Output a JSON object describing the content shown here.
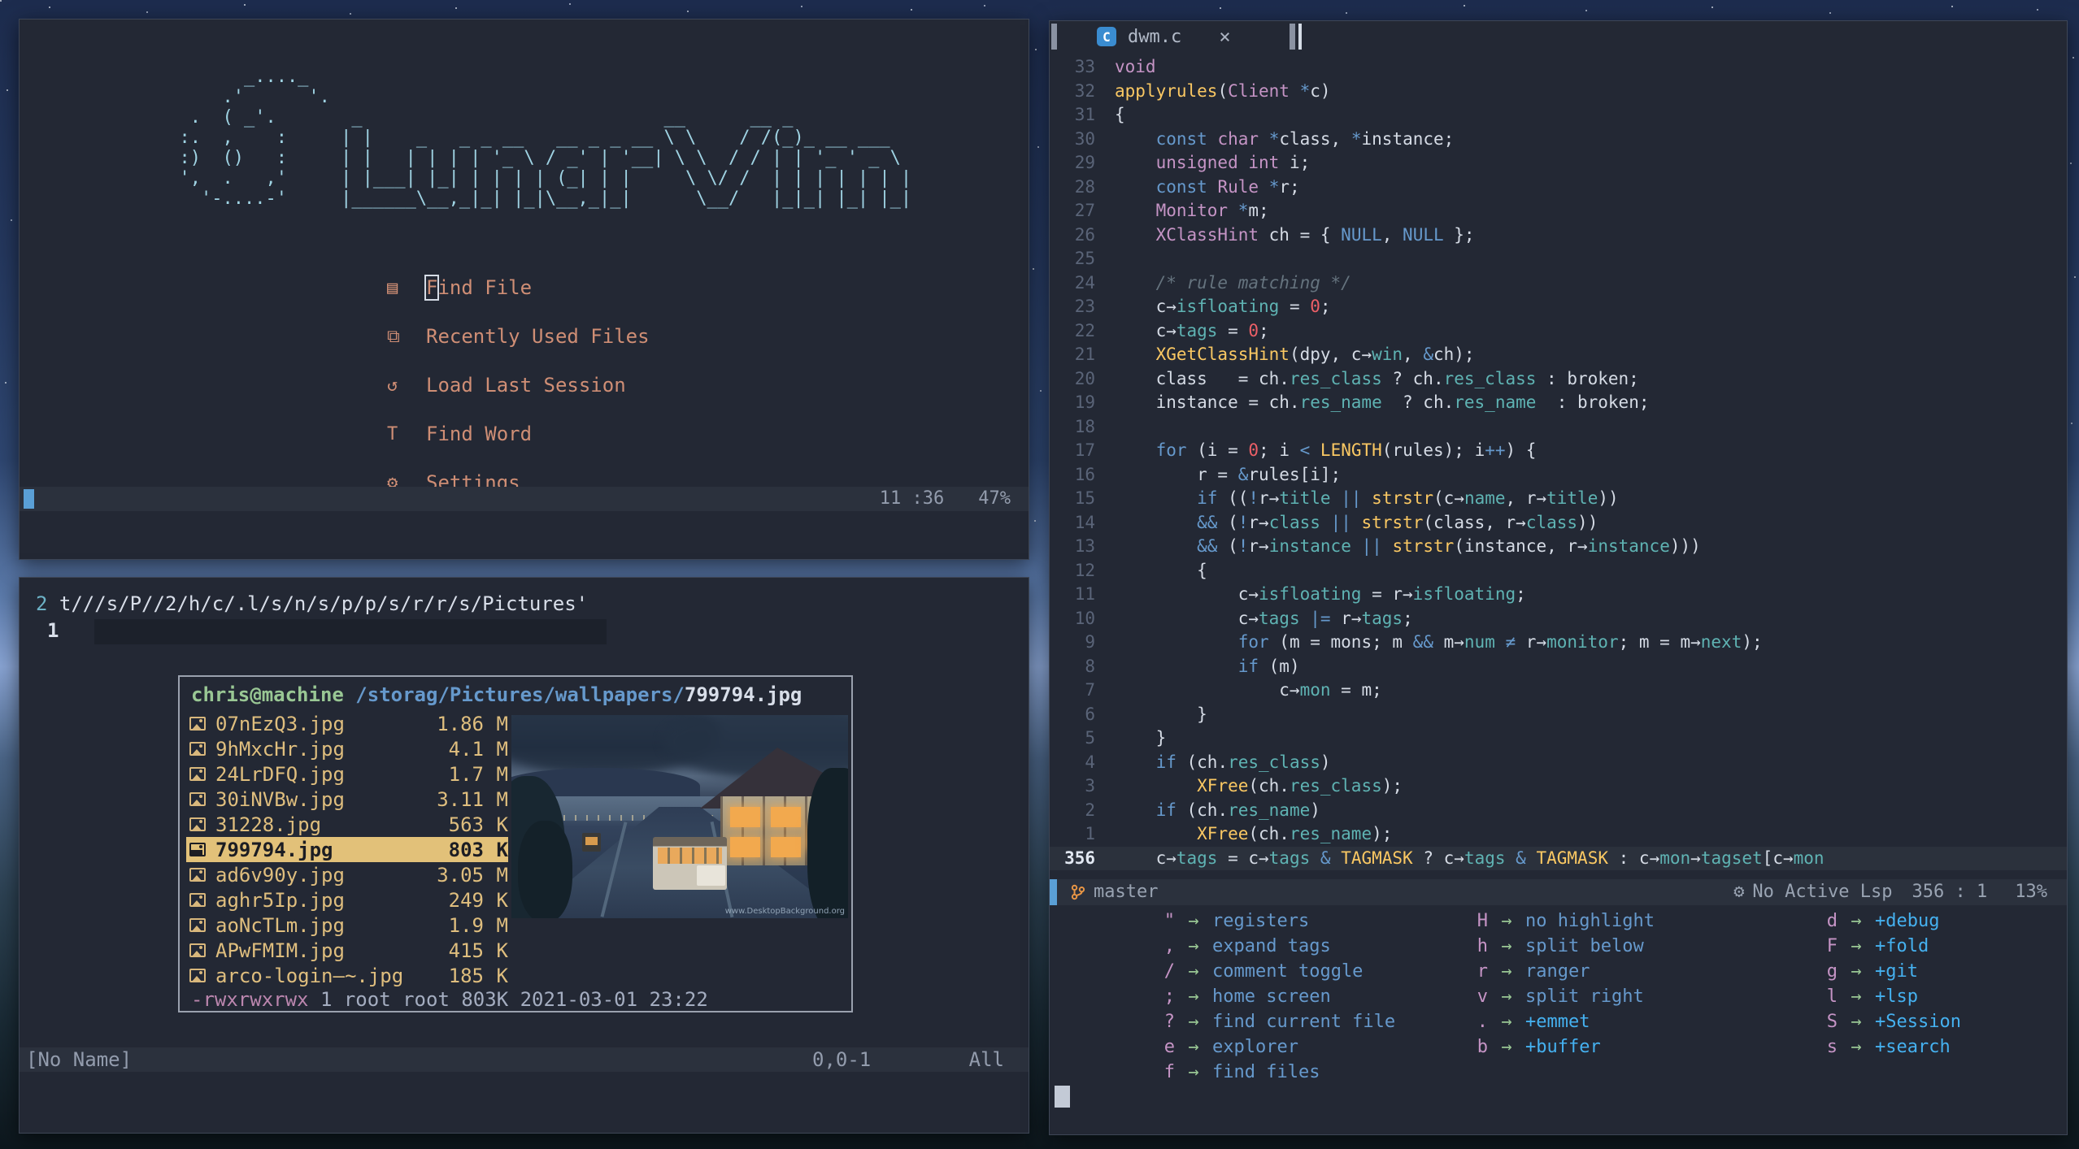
{
  "colors": {
    "bg": "#232834",
    "statusline_bg": "#2b313d",
    "accent_blue": "#5a9fd6",
    "menu_salmon": "#cf8e75",
    "logo_cyan": "#9fd3e3",
    "file_tan": "#dfbe7e",
    "select_tan": "#e2c179",
    "kw_blue": "#6699cc",
    "type_pink": "#c594c5",
    "fn_yellow": "#fac863",
    "member_teal": "#5fb3b3",
    "num_red": "#ec5f67",
    "green": "#99c794",
    "group_cyan": "#45b1f0",
    "branch_orange": "#e79545"
  },
  "lunarvim": {
    "ascii_art": "        _...._\n      .'      '.\n   .  ( _'.       _                            __      __ _\n  :.  ,    :     | |    _   _ _ __   __ _ _ __ \\ \\    / /(_)_ __ ___\n  :)  ()   :     | |   | | | | '_ \\ / _' | '__| \\ \\  / / | | '_ ' _ \\\n  ',  .   ,'     | |___| |_| | | | | (_| | |     \\ \\/ /  | | | | | | |\n    '-....-'     |______\\__,_|_| |_|\\__,_|_|      \\__/   |_|_| |_| |_|",
    "menu": [
      {
        "icon": "▤",
        "icon_name": "document-icon",
        "label": "Find File",
        "cursor": true
      },
      {
        "icon": "⧉",
        "icon_name": "copy-icon",
        "label": "Recently Used Files"
      },
      {
        "icon": "↺",
        "icon_name": "reload-icon",
        "label": "Load Last Session"
      },
      {
        "icon": "T",
        "icon_name": "text-icon",
        "label": "Find Word"
      },
      {
        "icon": "⚙",
        "icon_name": "gear-icon",
        "label": "Settings"
      }
    ],
    "statusline": {
      "time": "11 :36",
      "percent": "47%"
    }
  },
  "terminal": {
    "cmdline": {
      "num1": "2",
      "text": "t///s/P//2/h/c/.l/s/n/s/p/p/s/r/r/s/Pictures'",
      "num2": "1"
    },
    "fm": {
      "user": "chris@machine",
      "path": "/storag/Pictures/wallpapers/",
      "file": "799794.jpg",
      "files": [
        {
          "name": "07nEzQ3.jpg",
          "num": "1.86",
          "unit": "M"
        },
        {
          "name": "9hMxcHr.jpg",
          "num": "4.1",
          "unit": "M"
        },
        {
          "name": "24LrDFQ.jpg",
          "num": "1.7",
          "unit": "M"
        },
        {
          "name": "30iNVBw.jpg",
          "num": "3.11",
          "unit": "M"
        },
        {
          "name": "31228.jpg",
          "num": "563",
          "unit": "K"
        },
        {
          "name": "799794.jpg",
          "num": "803",
          "unit": "K",
          "selected": true
        },
        {
          "name": "ad6v90y.jpg",
          "num": "3.05",
          "unit": "M"
        },
        {
          "name": "aghr5Ip.jpg",
          "num": "249",
          "unit": "K"
        },
        {
          "name": "aoNcTLm.jpg",
          "num": "1.9",
          "unit": "M"
        },
        {
          "name": "APwFMIM.jpg",
          "num": "415",
          "unit": "K"
        },
        {
          "name": "arco-login—~.jpg",
          "num": "185",
          "unit": "K"
        }
      ],
      "perm_bits": "-rwxrwxrwx",
      "perm_meta": " 1 root root 803K 2021-03-01 23:22",
      "watermark": "www.DesktopBackground.org"
    },
    "statusline": {
      "name": "[No Name]",
      "pos": "0,0-1",
      "scroll": "All"
    }
  },
  "editor": {
    "tab": {
      "icon": "C",
      "label": "dwm.c",
      "close": "×"
    },
    "code": [
      {
        "ln": "33",
        "s": [
          [
            "t",
            "void"
          ]
        ]
      },
      {
        "ln": "32",
        "s": [
          [
            "f",
            "applyrules"
          ],
          [
            "p",
            "("
          ],
          [
            "t",
            "Client"
          ],
          [
            "p",
            " "
          ],
          [
            "k",
            "*"
          ],
          [
            "p",
            "c)"
          ]
        ]
      },
      {
        "ln": "31",
        "s": [
          [
            "p",
            "{"
          ]
        ]
      },
      {
        "ln": "30",
        "s": [
          [
            "p",
            "    "
          ],
          [
            "k",
            "const"
          ],
          [
            "p",
            " "
          ],
          [
            "t",
            "char"
          ],
          [
            "p",
            " "
          ],
          [
            "k",
            "*"
          ],
          [
            "p",
            "class, "
          ],
          [
            "k",
            "*"
          ],
          [
            "p",
            "instance;"
          ]
        ]
      },
      {
        "ln": "29",
        "s": [
          [
            "p",
            "    "
          ],
          [
            "t",
            "unsigned"
          ],
          [
            "p",
            " "
          ],
          [
            "t",
            "int"
          ],
          [
            "p",
            " i;"
          ]
        ]
      },
      {
        "ln": "28",
        "s": [
          [
            "p",
            "    "
          ],
          [
            "k",
            "const"
          ],
          [
            "p",
            " "
          ],
          [
            "t",
            "Rule"
          ],
          [
            "p",
            " "
          ],
          [
            "k",
            "*"
          ],
          [
            "p",
            "r;"
          ]
        ]
      },
      {
        "ln": "27",
        "s": [
          [
            "p",
            "    "
          ],
          [
            "t",
            "Monitor"
          ],
          [
            "p",
            " "
          ],
          [
            "k",
            "*"
          ],
          [
            "p",
            "m;"
          ]
        ]
      },
      {
        "ln": "26",
        "s": [
          [
            "p",
            "    "
          ],
          [
            "t",
            "XClassHint"
          ],
          [
            "p",
            " ch = { "
          ],
          [
            "k",
            "NULL"
          ],
          [
            "p",
            ", "
          ],
          [
            "k",
            "NULL"
          ],
          [
            "p",
            " };"
          ]
        ]
      },
      {
        "ln": "25",
        "s": []
      },
      {
        "ln": "24",
        "s": [
          [
            "c",
            "    /* rule matching */"
          ]
        ]
      },
      {
        "ln": "23",
        "s": [
          [
            "p",
            "    c→"
          ],
          [
            "m",
            "isfloating"
          ],
          [
            "p",
            " = "
          ],
          [
            "n",
            "0"
          ],
          [
            "p",
            ";"
          ]
        ]
      },
      {
        "ln": "22",
        "s": [
          [
            "p",
            "    c→"
          ],
          [
            "m",
            "tags"
          ],
          [
            "p",
            " = "
          ],
          [
            "n",
            "0"
          ],
          [
            "p",
            ";"
          ]
        ]
      },
      {
        "ln": "21",
        "s": [
          [
            "p",
            "    "
          ],
          [
            "f",
            "XGetClassHint"
          ],
          [
            "p",
            "(dpy, c→"
          ],
          [
            "m",
            "win"
          ],
          [
            "p",
            ", "
          ],
          [
            "k",
            "&"
          ],
          [
            "p",
            "ch);"
          ]
        ]
      },
      {
        "ln": "20",
        "s": [
          [
            "p",
            "    class   = ch."
          ],
          [
            "m",
            "res_class"
          ],
          [
            "p",
            " ? ch."
          ],
          [
            "m",
            "res_class"
          ],
          [
            "p",
            " : broken;"
          ]
        ]
      },
      {
        "ln": "19",
        "s": [
          [
            "p",
            "    instance = ch."
          ],
          [
            "m",
            "res_name"
          ],
          [
            "p",
            "  ? ch."
          ],
          [
            "m",
            "res_name"
          ],
          [
            "p",
            "  : broken;"
          ]
        ]
      },
      {
        "ln": "18",
        "s": []
      },
      {
        "ln": "17",
        "s": [
          [
            "p",
            "    "
          ],
          [
            "k",
            "for"
          ],
          [
            "p",
            " (i = "
          ],
          [
            "n",
            "0"
          ],
          [
            "p",
            "; i "
          ],
          [
            "k",
            "<"
          ],
          [
            "p",
            " "
          ],
          [
            "f",
            "LENGTH"
          ],
          [
            "p",
            "(rules); i"
          ],
          [
            "k",
            "++"
          ],
          [
            "p",
            ") {"
          ]
        ]
      },
      {
        "ln": "16",
        "s": [
          [
            "p",
            "        r = "
          ],
          [
            "k",
            "&"
          ],
          [
            "p",
            "rules[i];"
          ]
        ]
      },
      {
        "ln": "15",
        "s": [
          [
            "p",
            "        "
          ],
          [
            "k",
            "if"
          ],
          [
            "p",
            " (("
          ],
          [
            "k",
            "!"
          ],
          [
            "p",
            "r→"
          ],
          [
            "m",
            "title"
          ],
          [
            "p",
            " "
          ],
          [
            "k",
            "||"
          ],
          [
            "p",
            " "
          ],
          [
            "f",
            "strstr"
          ],
          [
            "p",
            "(c→"
          ],
          [
            "m",
            "name"
          ],
          [
            "p",
            ", r→"
          ],
          [
            "m",
            "title"
          ],
          [
            "p",
            "))"
          ]
        ]
      },
      {
        "ln": "14",
        "s": [
          [
            "p",
            "        "
          ],
          [
            "k",
            "&&"
          ],
          [
            "p",
            " ("
          ],
          [
            "k",
            "!"
          ],
          [
            "p",
            "r→"
          ],
          [
            "m",
            "class"
          ],
          [
            "p",
            " "
          ],
          [
            "k",
            "||"
          ],
          [
            "p",
            " "
          ],
          [
            "f",
            "strstr"
          ],
          [
            "p",
            "(class, r→"
          ],
          [
            "m",
            "class"
          ],
          [
            "p",
            "))"
          ]
        ]
      },
      {
        "ln": "13",
        "s": [
          [
            "p",
            "        "
          ],
          [
            "k",
            "&&"
          ],
          [
            "p",
            " ("
          ],
          [
            "k",
            "!"
          ],
          [
            "p",
            "r→"
          ],
          [
            "m",
            "instance"
          ],
          [
            "p",
            " "
          ],
          [
            "k",
            "||"
          ],
          [
            "p",
            " "
          ],
          [
            "f",
            "strstr"
          ],
          [
            "p",
            "(instance, r→"
          ],
          [
            "m",
            "instance"
          ],
          [
            "p",
            ")))"
          ]
        ]
      },
      {
        "ln": "12",
        "s": [
          [
            "p",
            "        {"
          ]
        ]
      },
      {
        "ln": "11",
        "s": [
          [
            "p",
            "            c→"
          ],
          [
            "m",
            "isfloating"
          ],
          [
            "p",
            " = r→"
          ],
          [
            "m",
            "isfloating"
          ],
          [
            "p",
            ";"
          ]
        ]
      },
      {
        "ln": "10",
        "s": [
          [
            "p",
            "            c→"
          ],
          [
            "m",
            "tags"
          ],
          [
            "p",
            " "
          ],
          [
            "k",
            "|="
          ],
          [
            "p",
            " r→"
          ],
          [
            "m",
            "tags"
          ],
          [
            "p",
            ";"
          ]
        ]
      },
      {
        "ln": "9",
        "s": [
          [
            "p",
            "            "
          ],
          [
            "k",
            "for"
          ],
          [
            "p",
            " (m = mons; m "
          ],
          [
            "k",
            "&&"
          ],
          [
            "p",
            " m→"
          ],
          [
            "m",
            "num"
          ],
          [
            "p",
            " "
          ],
          [
            "k",
            "≠"
          ],
          [
            "p",
            " r→"
          ],
          [
            "m",
            "monitor"
          ],
          [
            "p",
            "; m = m→"
          ],
          [
            "m",
            "next"
          ],
          [
            "p",
            ");"
          ]
        ]
      },
      {
        "ln": "8",
        "s": [
          [
            "p",
            "            "
          ],
          [
            "k",
            "if"
          ],
          [
            "p",
            " (m)"
          ]
        ]
      },
      {
        "ln": "7",
        "s": [
          [
            "p",
            "                c→"
          ],
          [
            "m",
            "mon"
          ],
          [
            "p",
            " = m;"
          ]
        ]
      },
      {
        "ln": "6",
        "s": [
          [
            "p",
            "        }"
          ]
        ]
      },
      {
        "ln": "5",
        "s": [
          [
            "p",
            "    }"
          ]
        ]
      },
      {
        "ln": "4",
        "s": [
          [
            "p",
            "    "
          ],
          [
            "k",
            "if"
          ],
          [
            "p",
            " (ch."
          ],
          [
            "m",
            "res_class"
          ],
          [
            "p",
            ")"
          ]
        ]
      },
      {
        "ln": "3",
        "s": [
          [
            "p",
            "        "
          ],
          [
            "f",
            "XFree"
          ],
          [
            "p",
            "(ch."
          ],
          [
            "m",
            "res_class"
          ],
          [
            "p",
            ");"
          ]
        ]
      },
      {
        "ln": "2",
        "s": [
          [
            "p",
            "    "
          ],
          [
            "k",
            "if"
          ],
          [
            "p",
            " (ch."
          ],
          [
            "m",
            "res_name"
          ],
          [
            "p",
            ")"
          ]
        ]
      },
      {
        "ln": "1",
        "s": [
          [
            "p",
            "        "
          ],
          [
            "f",
            "XFree"
          ],
          [
            "p",
            "(ch."
          ],
          [
            "m",
            "res_name"
          ],
          [
            "p",
            ");"
          ]
        ]
      },
      {
        "ln": "356",
        "cur": true,
        "s": [
          [
            "p",
            "    c→"
          ],
          [
            "m",
            "tags"
          ],
          [
            "p",
            " = c→"
          ],
          [
            "m",
            "tags"
          ],
          [
            "p",
            " "
          ],
          [
            "k",
            "&"
          ],
          [
            "p",
            " "
          ],
          [
            "f",
            "TAGMASK"
          ],
          [
            "p",
            " ? c→"
          ],
          [
            "m",
            "tags"
          ],
          [
            "p",
            " "
          ],
          [
            "k",
            "&"
          ],
          [
            "p",
            " "
          ],
          [
            "f",
            "TAGMASK"
          ],
          [
            "p",
            " : c→"
          ],
          [
            "m",
            "mon"
          ],
          [
            "p",
            "→"
          ],
          [
            "m",
            "tagset"
          ],
          [
            "p",
            "[c→"
          ],
          [
            "m",
            "mon"
          ]
        ]
      }
    ],
    "statusline": {
      "branch": "master",
      "gear": "⚙",
      "lsp": "No Active Lsp",
      "pos": "356 : 1",
      "percent": "13%"
    },
    "whichkey": {
      "arrow": "→",
      "col1": [
        {
          "key": "\"",
          "desc": "registers"
        },
        {
          "key": ",",
          "desc": "expand tags"
        },
        {
          "key": "/",
          "desc": "comment toggle"
        },
        {
          "key": ";",
          "desc": "home screen"
        },
        {
          "key": "?",
          "desc": "find current file"
        },
        {
          "key": "e",
          "desc": "explorer"
        },
        {
          "key": "f",
          "desc": "find files"
        }
      ],
      "col2": [
        {
          "key": "H",
          "desc": "no highlight"
        },
        {
          "key": "h",
          "desc": "split below"
        },
        {
          "key": "r",
          "desc": "ranger"
        },
        {
          "key": "v",
          "desc": "split right"
        },
        {
          "key": ".",
          "desc": "+emmet",
          "group": true
        },
        {
          "key": "b",
          "desc": "+buffer",
          "group": true
        }
      ],
      "col3": [
        {
          "key": "d",
          "desc": "+debug",
          "group": true
        },
        {
          "key": "F",
          "desc": "+fold",
          "group": true
        },
        {
          "key": "g",
          "desc": "+git",
          "group": true
        },
        {
          "key": "l",
          "desc": "+lsp",
          "group": true
        },
        {
          "key": "S",
          "desc": "+Session",
          "group": true
        },
        {
          "key": "s",
          "desc": "+search",
          "group": true
        }
      ]
    }
  }
}
